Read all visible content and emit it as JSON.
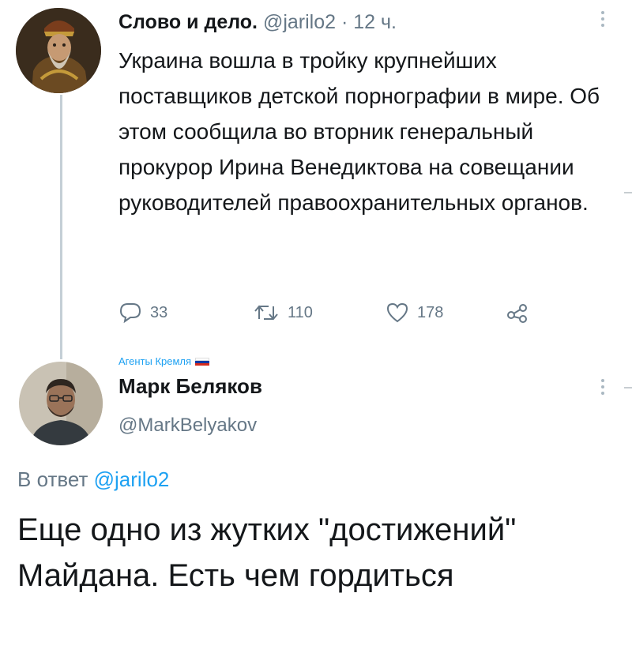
{
  "tweet1": {
    "author_name": "Слово и дело.",
    "handle": "@jarilo2",
    "separator": "·",
    "time": "12 ч.",
    "text": "Украина вошла в тройку крупнейших поставщиков детской порнографии в мире. Об этом сообщила во вторник генеральный прокурор Ирина Венедиктова на совещании руководителей правоохранительных органов.",
    "actions": {
      "replies": "33",
      "retweets": "110",
      "likes": "178"
    },
    "icons": {
      "reply": "reply-icon",
      "retweet": "retweet-icon",
      "like": "heart-icon",
      "share": "share-icon",
      "more": "more-vertical-icon"
    }
  },
  "tweet2": {
    "label": "Агенты Кремля",
    "author_name": "Марк Беляков",
    "handle": "@MarkBelyakov",
    "reply_prefix": "В ответ",
    "reply_mention": "@jarilo2",
    "text": "Еще одно из жутких \"достижений\" Майдана. Есть чем гордиться"
  },
  "colors": {
    "text": "#14171a",
    "secondary": "#657786",
    "accent": "#1da1f2",
    "thread_line": "#c4cfd6"
  }
}
